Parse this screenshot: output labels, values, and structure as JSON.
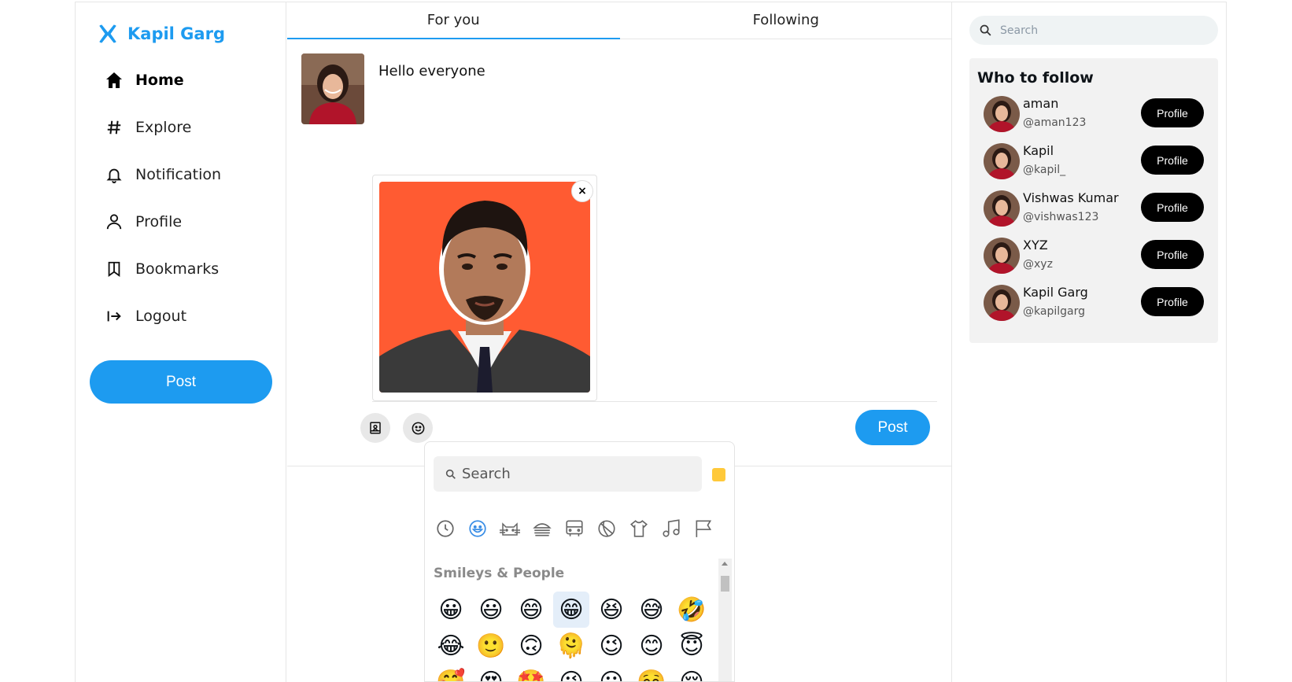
{
  "brand": {
    "name": "Kapil Garg",
    "logo": "x-logo-icon",
    "accent": "#1d9bf0"
  },
  "nav": {
    "items": [
      {
        "label": "Home",
        "icon": "home-icon",
        "active": true
      },
      {
        "label": "Explore",
        "icon": "hashtag-icon"
      },
      {
        "label": "Notification",
        "icon": "bell-icon"
      },
      {
        "label": "Profile",
        "icon": "person-icon"
      },
      {
        "label": "Bookmarks",
        "icon": "bookmark-icon"
      },
      {
        "label": "Logout",
        "icon": "logout-icon"
      }
    ],
    "post_label": "Post"
  },
  "tabs": [
    {
      "label": "For you",
      "active": true
    },
    {
      "label": "Following"
    }
  ],
  "compose": {
    "text": "Hello everyone",
    "post_label": "Post",
    "media_close": "×",
    "tools": [
      "image-icon",
      "smiley-icon"
    ]
  },
  "emoji_picker": {
    "search_placeholder": "Search",
    "section_title": "Smileys & People",
    "categories": [
      "recent-icon",
      "smileys-icon",
      "animals-icon",
      "food-icon",
      "travel-icon",
      "activity-icon",
      "objects-icon",
      "symbols-icon",
      "flags-icon"
    ],
    "emojis": [
      "😀",
      "😃",
      "😄",
      "😁",
      "😆",
      "😅",
      "🤣",
      "😂",
      "🙂",
      "🙃",
      "🫠",
      "😉",
      "😊",
      "😇",
      "🥰",
      "😍",
      "🤩",
      "😘",
      "😗",
      "☺️",
      "😚"
    ],
    "selected_index": 3,
    "tone_color": "#ffc93a"
  },
  "right": {
    "search_placeholder": "Search",
    "who_to_follow": {
      "title": "Who to follow",
      "users": [
        {
          "name": "aman",
          "handle": "@aman123",
          "button": "Profile"
        },
        {
          "name": "Kapil",
          "handle": "@kapil_",
          "button": "Profile"
        },
        {
          "name": "Vishwas Kumar",
          "handle": "@vishwas123",
          "button": "Profile"
        },
        {
          "name": "XYZ",
          "handle": "@xyz",
          "button": "Profile"
        },
        {
          "name": "Kapil Garg",
          "handle": "@kapilgarg",
          "button": "Profile"
        }
      ]
    }
  }
}
